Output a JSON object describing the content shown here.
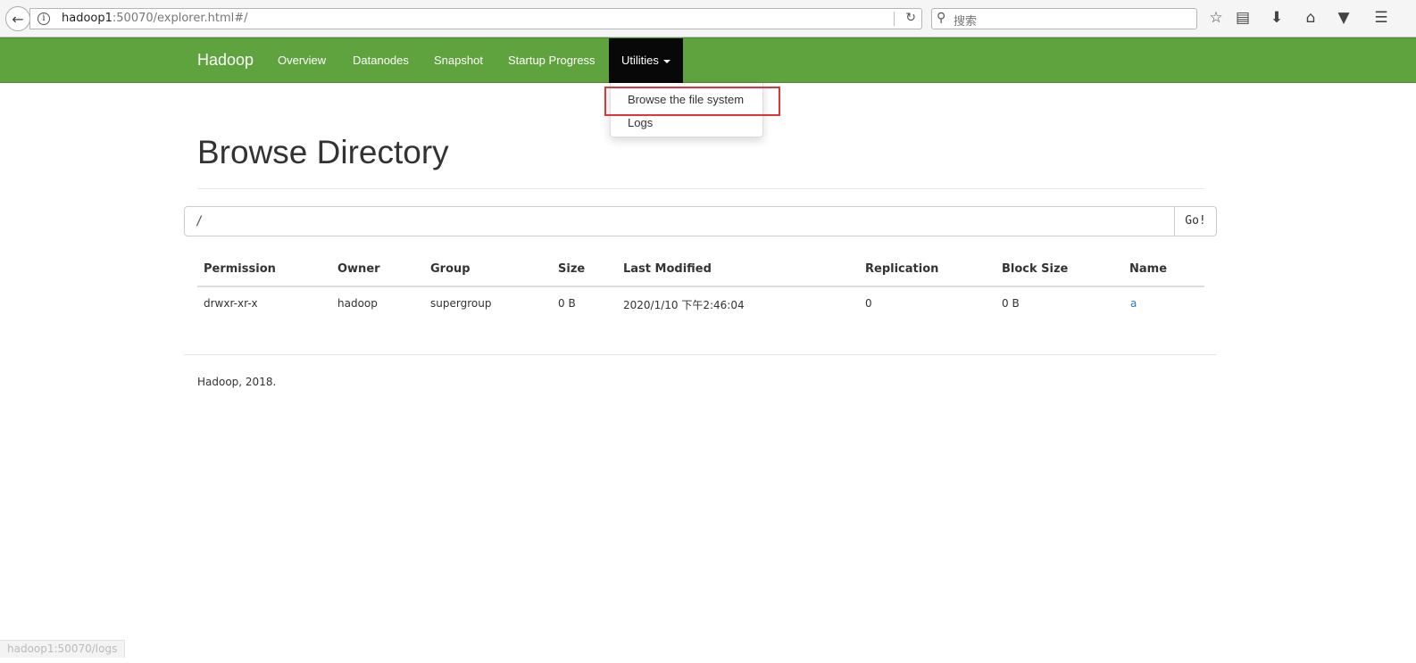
{
  "browser": {
    "url_host": "hadoop1",
    "url_rest": ":50070/explorer.html#/",
    "search_placeholder": "搜索",
    "status_link": "hadoop1:50070/logs"
  },
  "navbar": {
    "brand": "Hadoop",
    "items": [
      "Overview",
      "Datanodes",
      "Snapshot",
      "Startup Progress"
    ],
    "utilities_label": "Utilities",
    "bg_color": "#5fa33e"
  },
  "dropdown": {
    "items": [
      "Browse the file system",
      "Logs"
    ]
  },
  "page": {
    "title": "Browse Directory",
    "path_value": "/",
    "go_label": "Go!"
  },
  "table": {
    "headers": [
      "Permission",
      "Owner",
      "Group",
      "Size",
      "Last Modified",
      "Replication",
      "Block Size",
      "Name"
    ],
    "rows": [
      [
        "drwxr-xr-x",
        "hadoop",
        "supergroup",
        "0 B",
        "2020/1/10 下午2:46:04",
        "0",
        "0 B",
        "a"
      ]
    ]
  },
  "footer": {
    "text": "Hadoop, 2018."
  }
}
